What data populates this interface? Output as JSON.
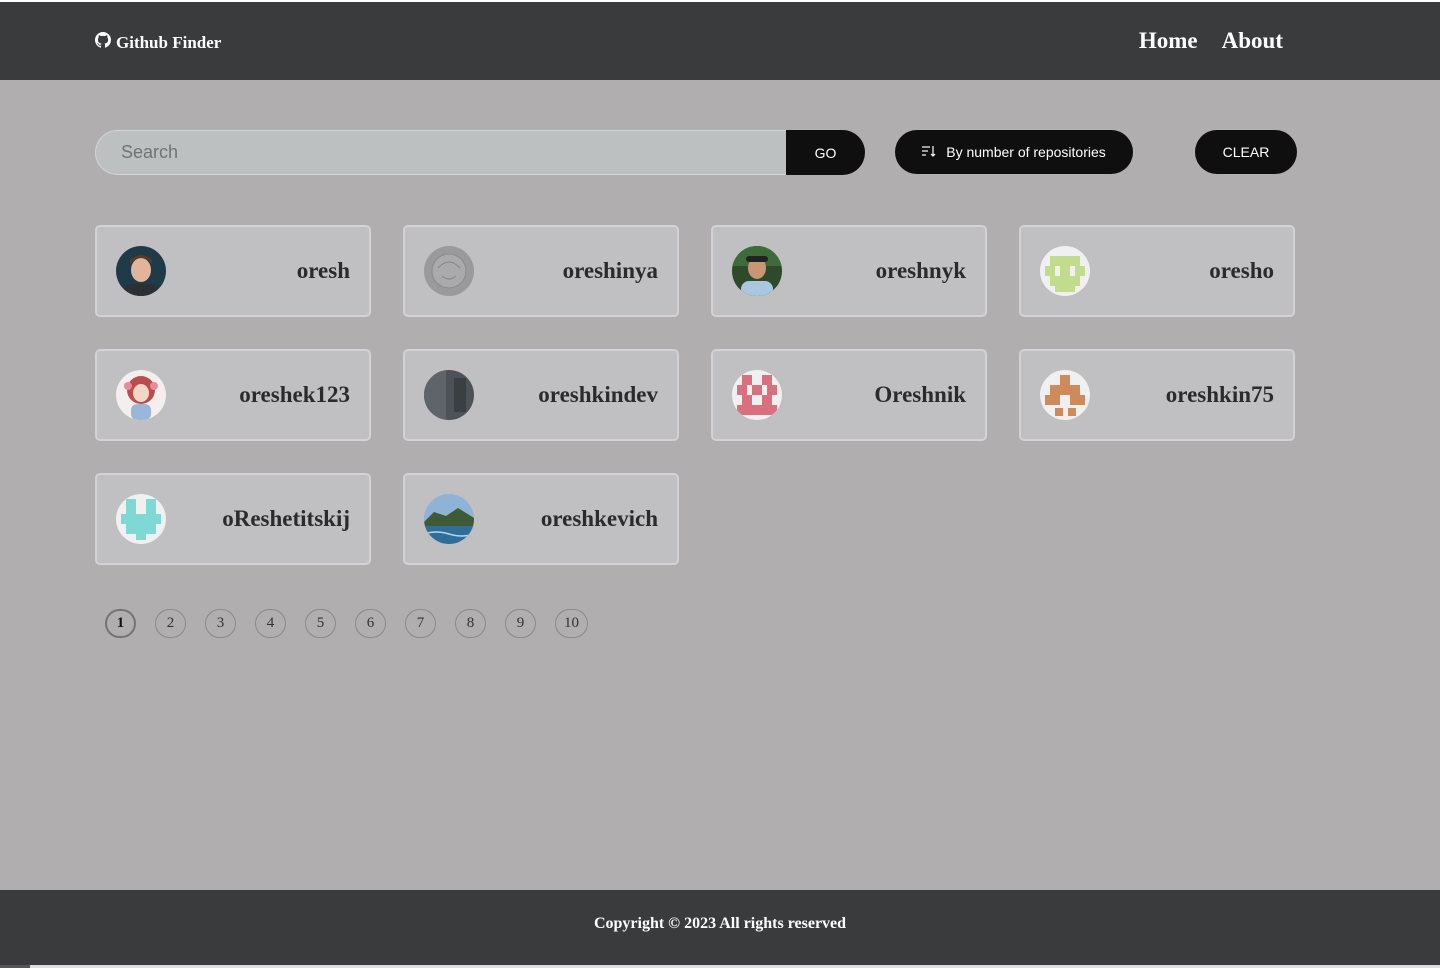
{
  "header": {
    "brand": "Github Finder",
    "brand_icon": "github-icon",
    "nav": [
      {
        "label": "Home"
      },
      {
        "label": "About"
      }
    ]
  },
  "search": {
    "placeholder": "Search",
    "value": "",
    "go_label": "GO",
    "sort_label": "By number of repositories",
    "sort_icon": "sort-icon",
    "clear_label": "CLEAR"
  },
  "users": [
    {
      "login": "oresh"
    },
    {
      "login": "oreshinya"
    },
    {
      "login": "oreshnyk"
    },
    {
      "login": "oresho"
    },
    {
      "login": "oreshek123"
    },
    {
      "login": "oreshkindev"
    },
    {
      "login": "Oreshnik"
    },
    {
      "login": "oreshkin75"
    },
    {
      "login": "oReshetitskij"
    },
    {
      "login": "oreshkevich"
    }
  ],
  "pagination": {
    "pages": [
      "1",
      "2",
      "3",
      "4",
      "5",
      "6",
      "7",
      "8",
      "9",
      "10"
    ],
    "current": "1"
  },
  "footer": {
    "copyright": "Copyright © 2023 All rights reserved"
  },
  "colors": {
    "header_bg": "#3a3b3d",
    "page_bg": "#b0aeaf",
    "button_bg": "#0f0f0f",
    "card_bg": "#c0bfc1"
  }
}
